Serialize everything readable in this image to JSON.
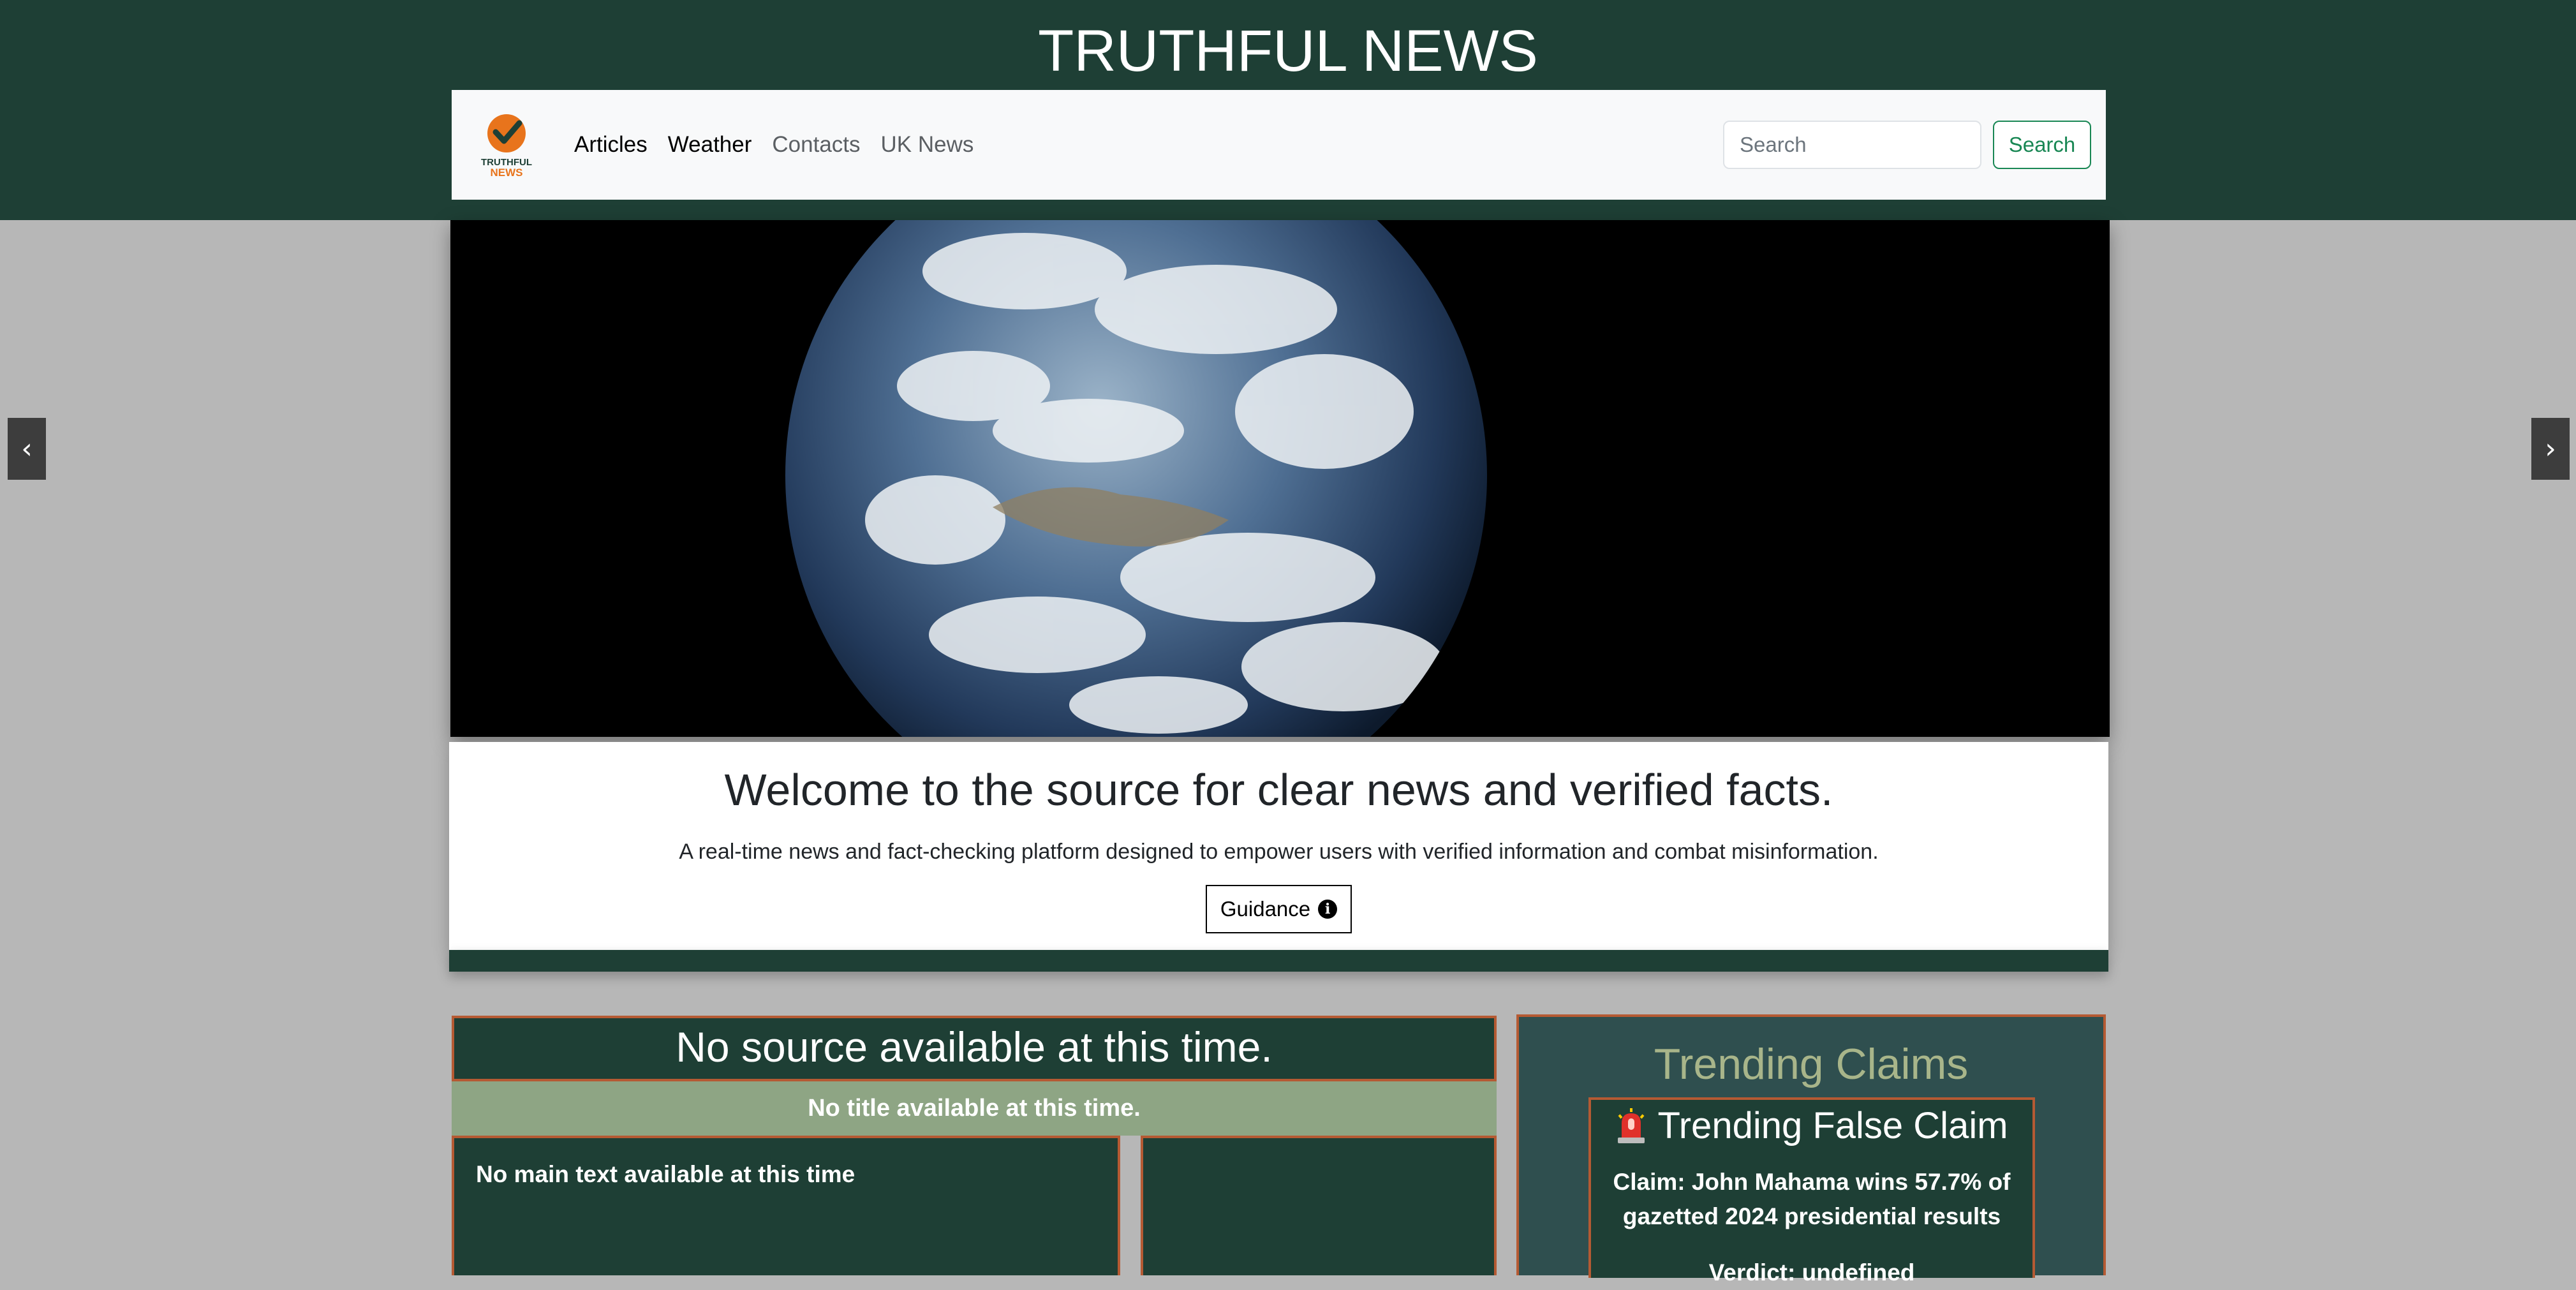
{
  "header": {
    "site_title": "TRUTHFUL NEWS"
  },
  "logo": {
    "line1": "TRUTHFUL",
    "line2": "NEWS"
  },
  "nav": {
    "links": [
      {
        "label": "Articles"
      },
      {
        "label": "Weather"
      },
      {
        "label": "Contacts"
      },
      {
        "label": "UK News"
      }
    ],
    "search_placeholder": "Search",
    "search_button": "Search"
  },
  "carousel": {
    "prev_label": "‹",
    "next_label": "›",
    "slide_image": "earth-from-space"
  },
  "welcome": {
    "heading": "Welcome to the source for clear news and verified facts.",
    "text": "A real-time news and fact-checking platform designed to empower users with verified information and combat misinformation.",
    "guidance_button": "Guidance",
    "info_icon": "i"
  },
  "article": {
    "source": "No source available at this time.",
    "title": "No title available at this time.",
    "main_text": "No main text available at this time"
  },
  "trending": {
    "heading": "Trending Claims",
    "card_title": "Trending False Claim",
    "claim_label": "Claim:",
    "claim_text": "John Mahama wins 57.7% of gazetted 2024 presidential results",
    "verdict_label": "Verdict:",
    "verdict_value": "undefined"
  },
  "colors": {
    "header_bg": "#1e3f35",
    "page_bg": "#b7b7b7",
    "accent_orange": "#b55a33",
    "title_band": "#8ea584",
    "trending_heading": "#a8b58a",
    "search_green": "#198754"
  }
}
